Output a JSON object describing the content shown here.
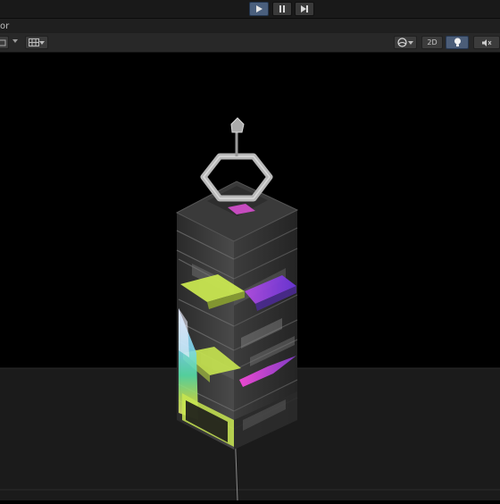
{
  "playmode": {
    "play_icon": "play-icon",
    "pause_icon": "pause-icon",
    "step_icon": "step-icon",
    "play_active": true
  },
  "scene_tab": {
    "title_fragment": "or"
  },
  "scene_toolbar": {
    "shading_icon": "shading-mode-icon",
    "gizmo_icon": "gizmos-grid-icon",
    "camera_icon": "camera-sphere-icon",
    "mode_2d_label": "2D",
    "lighting_icon": "lightbulb-icon",
    "audio_icon": "audio-mute-icon"
  },
  "scene": {
    "background_color": "#000000",
    "ground_color": "#1b1b1b",
    "accent_colors": {
      "yellow_green": "#c8e650",
      "violet": "#8a3fe0",
      "magenta": "#e04ad8",
      "cyan": "#58d8e8",
      "frame_silver": "#b8b8b8"
    }
  }
}
